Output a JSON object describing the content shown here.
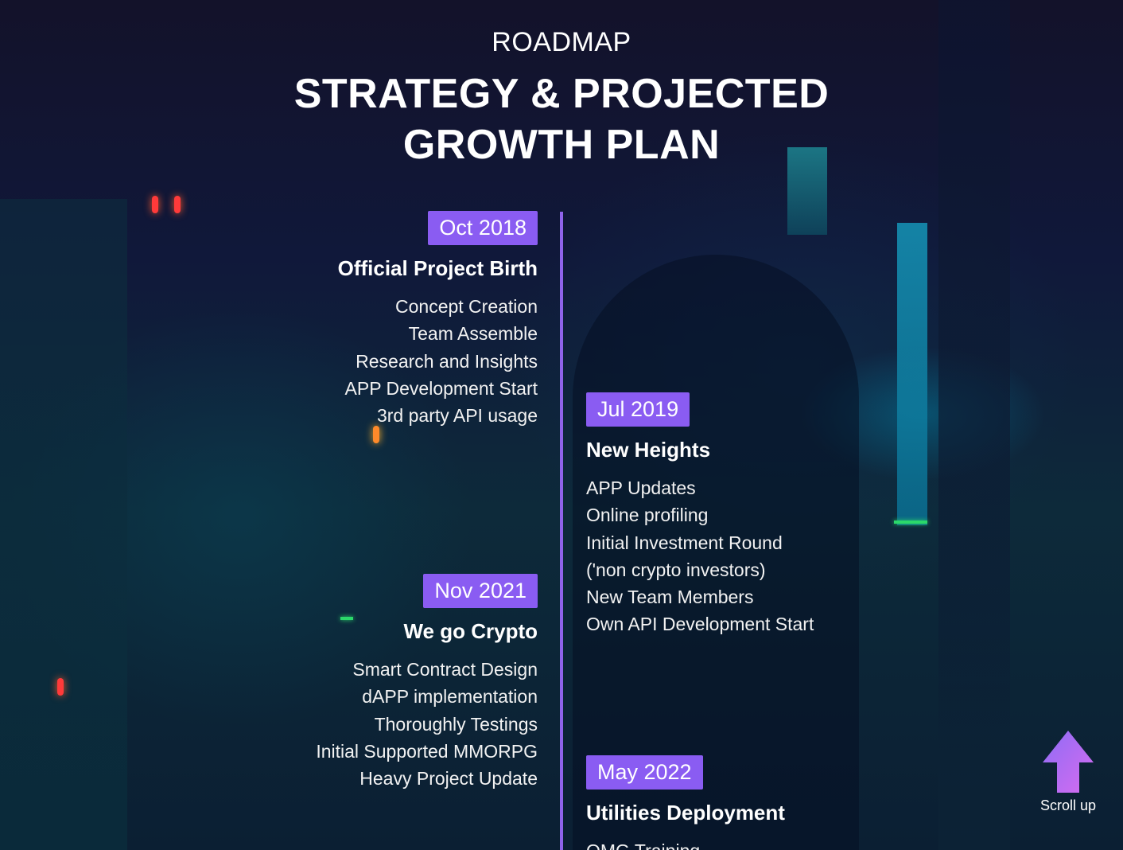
{
  "header": {
    "kicker": "ROADMAP",
    "title_line1": "STRATEGY & PROJECTED",
    "title_line2": "GROWTH PLAN"
  },
  "timeline": [
    {
      "date": "Oct 2018",
      "title": "Official Project Birth",
      "items": [
        "Concept Creation",
        "Team Assemble",
        "Research and Insights",
        "APP Development Start",
        "3rd party API usage"
      ]
    },
    {
      "date": "Jul 2019",
      "title": "New Heights",
      "items": [
        "APP Updates",
        "Online profiling",
        "Initial Investment Round",
        "('non crypto investors)",
        "New Team Members",
        "Own API Development Start"
      ]
    },
    {
      "date": "Nov 2021",
      "title": "We go Crypto",
      "items": [
        "Smart Contract Design",
        "dAPP implementation",
        "Thoroughly Testings",
        "Initial Supported MMORPG",
        "Heavy Project Update"
      ]
    },
    {
      "date": "May 2022",
      "title": "Utilities Deployment",
      "items": [
        "OMG Training"
      ]
    }
  ],
  "scroll_up": {
    "label": "Scroll up",
    "icon": "arrow-up-icon"
  },
  "colors": {
    "accent": "#8a5cf2",
    "timeline_line": "#8f63ea",
    "scroll_arrow_top": "#8e6cf5",
    "scroll_arrow_bottom": "#d66cf0"
  }
}
